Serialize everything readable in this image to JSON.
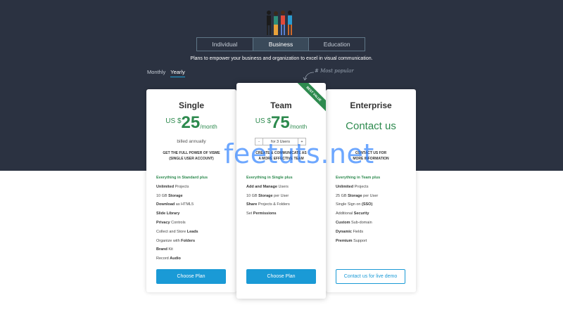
{
  "tabs": [
    {
      "label": "Individual"
    },
    {
      "label": "Business",
      "active": true
    },
    {
      "label": "Education"
    }
  ],
  "tagline": "Plans to empower your business and organization to excel in visual communication.",
  "billing": {
    "monthly": "Monthly",
    "yearly": "Yearly",
    "selected": "Yearly"
  },
  "most_popular": "# Most popular",
  "plans": {
    "single": {
      "title": "Single",
      "currency": "US $",
      "price": "25",
      "period": "/month",
      "billed": "billed annually",
      "desc_line1": "GET THE FULL POWER OF VISME",
      "desc_line2": "(SINGLE USER ACCOUNT)",
      "button": "Choose Plan"
    },
    "team": {
      "title": "Team",
      "ribbon": "BEST VALUE",
      "currency": "US $",
      "price": "75",
      "period": "/month",
      "users_minus": "-",
      "users_value": "for 3 Users",
      "users_plus": "+",
      "desc_line1": "CREATE & COMMUNICATE AS",
      "desc_line2": "A MORE EFFECTIVE TEAM",
      "button": "Choose Plan"
    },
    "enterprise": {
      "title": "Enterprise",
      "contact": "Contact us",
      "desc_line1": "CONTACT US FOR",
      "desc_line2": "MORE INFORMATION",
      "button": "Contact us for live demo"
    }
  },
  "features": {
    "single": [
      {
        "bold": "Everything in Standard",
        "rest": " plus",
        "lead": true
      },
      {
        "bold": "Unlimited",
        "rest": " Projects"
      },
      {
        "pre": "10 GB ",
        "bold": "Storage",
        "rest": ""
      },
      {
        "bold": "Download",
        "rest": " as HTML5"
      },
      {
        "bold": "Slide Library",
        "rest": ""
      },
      {
        "bold": "Privacy",
        "rest": " Controls"
      },
      {
        "pre": "Collect and Store ",
        "bold": "Leads",
        "rest": ""
      },
      {
        "pre": "Organize with ",
        "bold": "Folders",
        "rest": ""
      },
      {
        "bold": "Brand",
        "rest": " Kit"
      },
      {
        "pre": "Record ",
        "bold": "Audio",
        "rest": ""
      }
    ],
    "team": [
      {
        "bold": "Everything in Single",
        "rest": " plus",
        "lead": true
      },
      {
        "bold": "Add and Manage",
        "rest": " Users"
      },
      {
        "pre": "10 GB ",
        "bold": "Storage",
        "rest": " per User"
      },
      {
        "bold": "Share",
        "rest": " Projects & Folders"
      },
      {
        "pre": "Set ",
        "bold": "Permissions",
        "rest": ""
      }
    ],
    "enterprise": [
      {
        "bold": "Everything in Team",
        "rest": " plus",
        "lead": true
      },
      {
        "bold": "Unlimited",
        "rest": " Projects"
      },
      {
        "pre": "25 GB ",
        "bold": "Storage",
        "rest": " per User"
      },
      {
        "pre": "Single Sign on ",
        "bold": "(SSO)",
        "rest": ""
      },
      {
        "pre": "Additional ",
        "bold": "Security",
        "rest": ""
      },
      {
        "bold": "Custom",
        "rest": " Sub-domain"
      },
      {
        "bold": "Dynamic",
        "rest": " Fields"
      },
      {
        "bold": "Premium",
        "rest": " Support"
      }
    ]
  },
  "watermark": "feetuts.net",
  "colors": {
    "hero_bg": "#2b3241",
    "accent": "#1a9ad6",
    "green": "#2d8a4e"
  }
}
